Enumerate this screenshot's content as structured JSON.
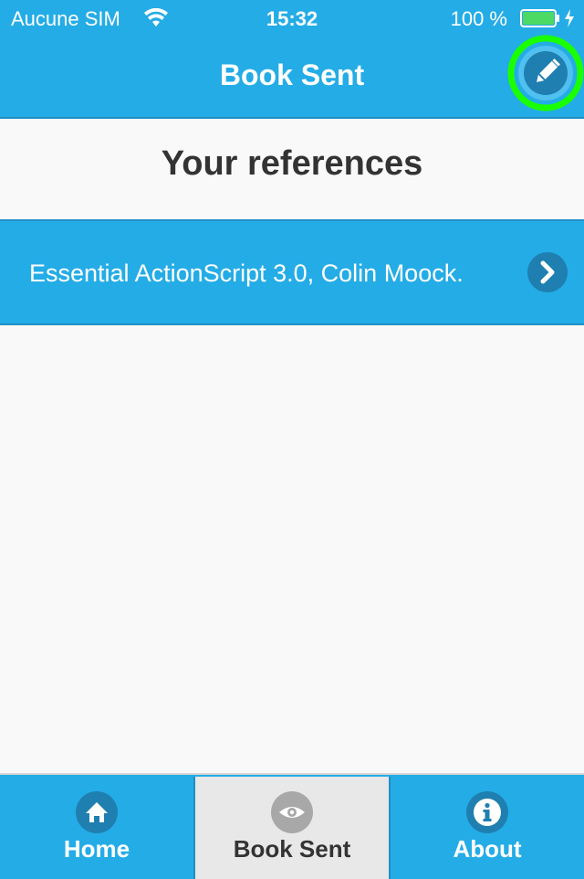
{
  "status_bar": {
    "carrier": "Aucune SIM",
    "time": "15:32",
    "battery": "100 %"
  },
  "nav": {
    "title": "Book Sent",
    "edit_icon": "pencil-icon"
  },
  "content": {
    "section_title": "Your references",
    "items": [
      {
        "label": "Essential ActionScript 3.0, Colin Moock."
      }
    ]
  },
  "tabbar": {
    "tabs": [
      {
        "label": "Home",
        "icon": "home-icon",
        "active": false
      },
      {
        "label": "Book Sent",
        "icon": "eye-icon",
        "active": true
      },
      {
        "label": "About",
        "icon": "info-icon",
        "active": false
      }
    ]
  },
  "colors": {
    "primary": "#24ace6",
    "highlight_ring": "#19ff00",
    "battery_fill": "#4cd964"
  }
}
